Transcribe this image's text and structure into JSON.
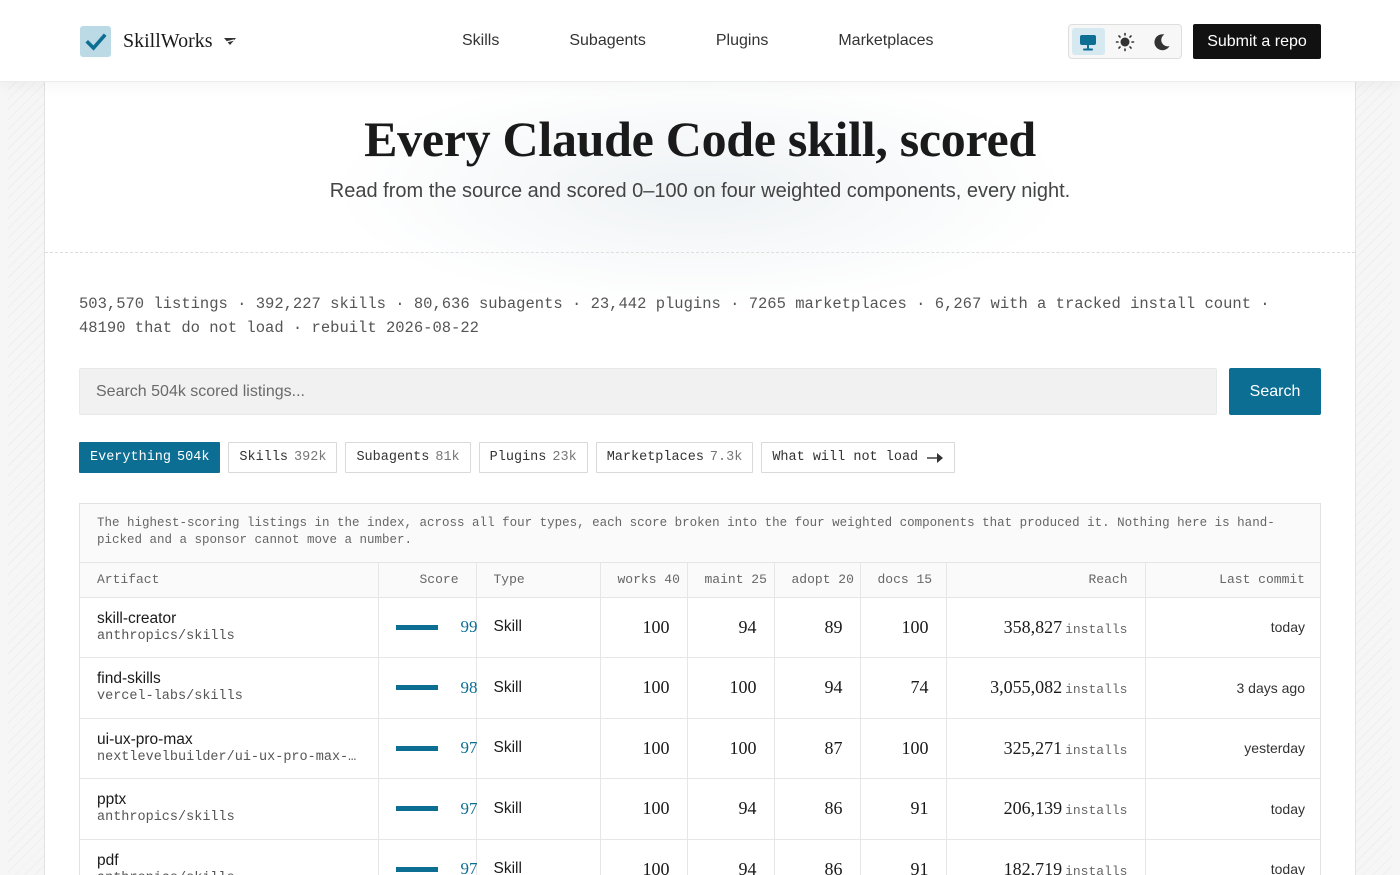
{
  "header": {
    "brand": "SkillWorks",
    "nav": [
      "Skills",
      "Subagents",
      "Plugins",
      "Marketplaces"
    ],
    "theme_modes": [
      "monitor-icon",
      "sun-icon",
      "moon-icon"
    ],
    "active_theme": "monitor-icon",
    "submit_label": "Submit a repo"
  },
  "hero": {
    "title": "Every Claude Code skill, scored",
    "subtitle": "Read from the source and scored 0–100 on four weighted components, every night."
  },
  "stats": "503,570 listings · 392,227 skills · 80,636 subagents · 23,442 plugins · 7265 marketplaces · 6,267 with a tracked install count · 48190 that do not load · rebuilt 2026-08-22",
  "search": {
    "placeholder": "Search 504k scored listings...",
    "button": "Search"
  },
  "filters": [
    {
      "label": "Everything",
      "count": "504k",
      "active": true
    },
    {
      "label": "Skills",
      "count": "392k",
      "active": false
    },
    {
      "label": "Subagents",
      "count": "81k",
      "active": false
    },
    {
      "label": "Plugins",
      "count": "23k",
      "active": false
    },
    {
      "label": "Marketplaces",
      "count": "7.3k",
      "active": false
    },
    {
      "label": "What will not load",
      "count": "",
      "active": false
    }
  ],
  "table": {
    "caption": "The highest-scoring listings in the index, across all four types, each score broken into the four weighted components that produced it. Nothing here is hand-picked and a sponsor cannot move a number.",
    "columns": [
      "Artifact",
      "Score",
      "Type",
      "works 40",
      "maint 25",
      "adopt 20",
      "docs 15",
      "Reach",
      "Last commit"
    ],
    "reach_unit": "installs",
    "rows": [
      {
        "name": "skill-creator",
        "repo": "anthropics/skills",
        "score": "99",
        "type": "Skill",
        "works": "100",
        "maint": "94",
        "adopt": "89",
        "docs": "100",
        "reach": "358,827",
        "commit": "today"
      },
      {
        "name": "find-skills",
        "repo": "vercel-labs/skills",
        "score": "98",
        "type": "Skill",
        "works": "100",
        "maint": "100",
        "adopt": "94",
        "docs": "74",
        "reach": "3,055,082",
        "commit": "3 days ago"
      },
      {
        "name": "ui-ux-pro-max",
        "repo": "nextlevelbuilder/ui-ux-pro-max-s…",
        "score": "97",
        "type": "Skill",
        "works": "100",
        "maint": "100",
        "adopt": "87",
        "docs": "100",
        "reach": "325,271",
        "commit": "yesterday"
      },
      {
        "name": "pptx",
        "repo": "anthropics/skills",
        "score": "97",
        "type": "Skill",
        "works": "100",
        "maint": "94",
        "adopt": "86",
        "docs": "91",
        "reach": "206,139",
        "commit": "today"
      },
      {
        "name": "pdf",
        "repo": "anthropics/skills",
        "score": "97",
        "type": "Skill",
        "works": "100",
        "maint": "94",
        "adopt": "86",
        "docs": "91",
        "reach": "182,719",
        "commit": "today"
      }
    ]
  },
  "colors": {
    "accent": "#0d6e93",
    "submit_bg": "#111111",
    "logo_bg": "#bcd9e6"
  }
}
